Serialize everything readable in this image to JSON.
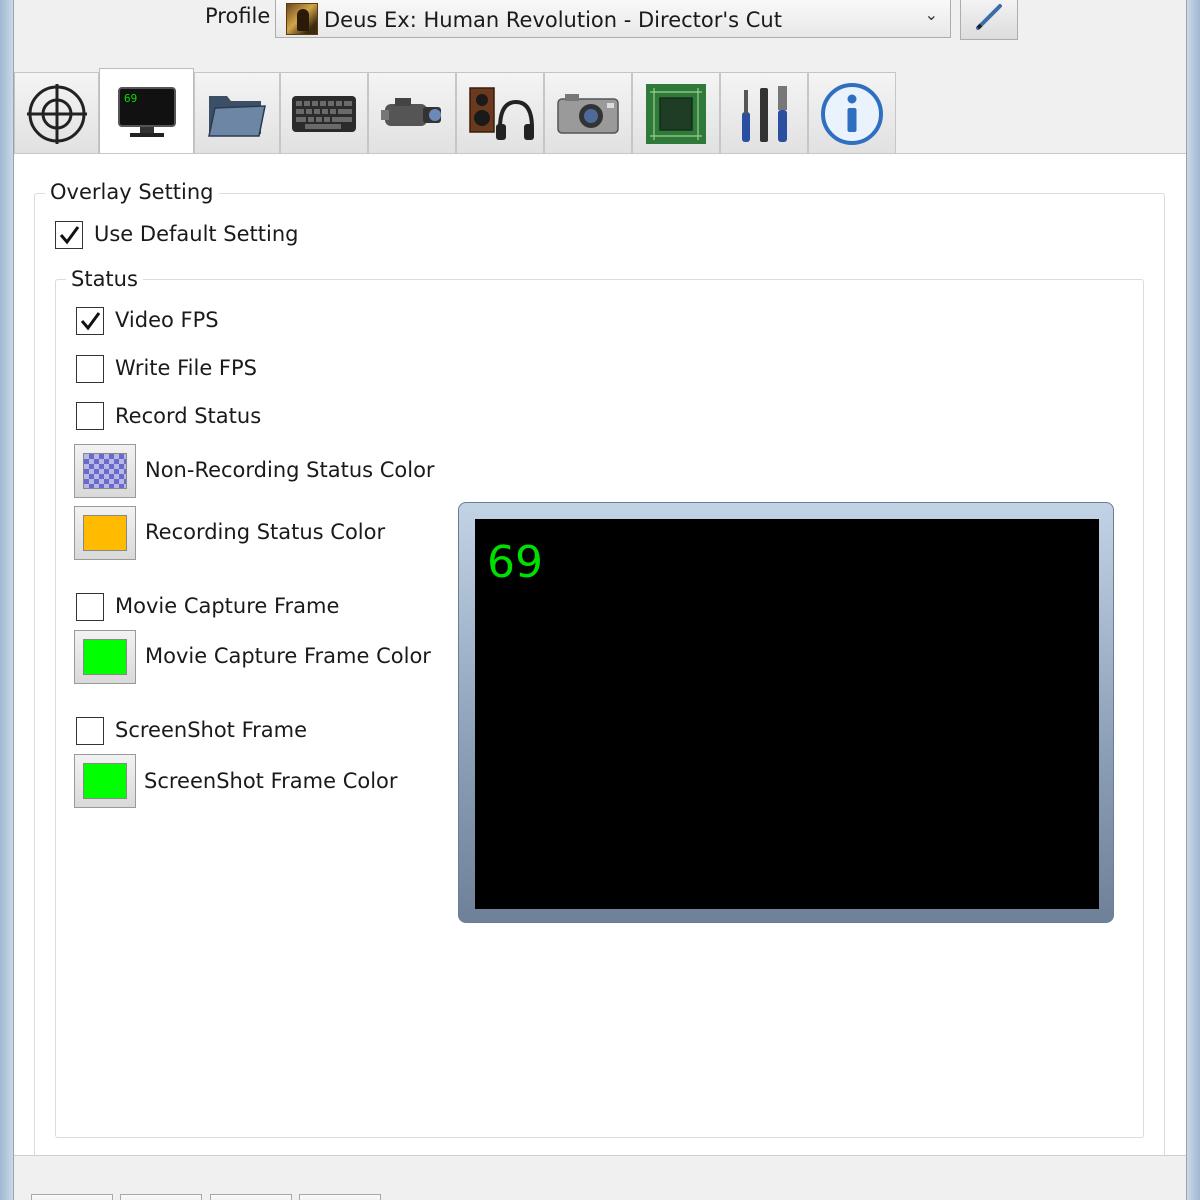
{
  "profile": {
    "label": "Profile",
    "value": "Deus Ex: Human Revolution - Director's Cut"
  },
  "tabs": [
    {
      "icon": "crosshair-icon"
    },
    {
      "icon": "monitor-overlay-icon",
      "active": true,
      "badge": "69"
    },
    {
      "icon": "folder-icon"
    },
    {
      "icon": "keyboard-icon"
    },
    {
      "icon": "camcorder-icon"
    },
    {
      "icon": "speaker-headphones-icon"
    },
    {
      "icon": "camera-icon"
    },
    {
      "icon": "gpu-chip-icon"
    },
    {
      "icon": "tools-icon"
    },
    {
      "icon": "info-icon"
    }
  ],
  "overlay": {
    "title": "Overlay Setting",
    "use_default_label": "Use Default Setting",
    "use_default_checked": true
  },
  "status": {
    "title": "Status",
    "video_fps_label": "Video FPS",
    "video_fps_checked": true,
    "write_file_fps_label": "Write File FPS",
    "write_file_fps_checked": false,
    "record_status_label": "Record Status",
    "record_status_checked": false,
    "non_recording_color_label": "Non-Recording Status Color",
    "non_recording_color": "transparent-checker",
    "recording_color_label": "Recording Status Color",
    "recording_color": "#ffbb00",
    "movie_capture_frame_label": "Movie Capture Frame",
    "movie_capture_frame_checked": false,
    "movie_capture_frame_color_label": "Movie Capture Frame Color",
    "movie_capture_frame_color": "#00ff00",
    "screenshot_frame_label": "ScreenShot Frame",
    "screenshot_frame_checked": false,
    "screenshot_frame_color_label": "ScreenShot Frame Color",
    "screenshot_frame_color": "#00ff00"
  },
  "preview": {
    "fps_text": "69",
    "fps_color": "#00e000"
  }
}
